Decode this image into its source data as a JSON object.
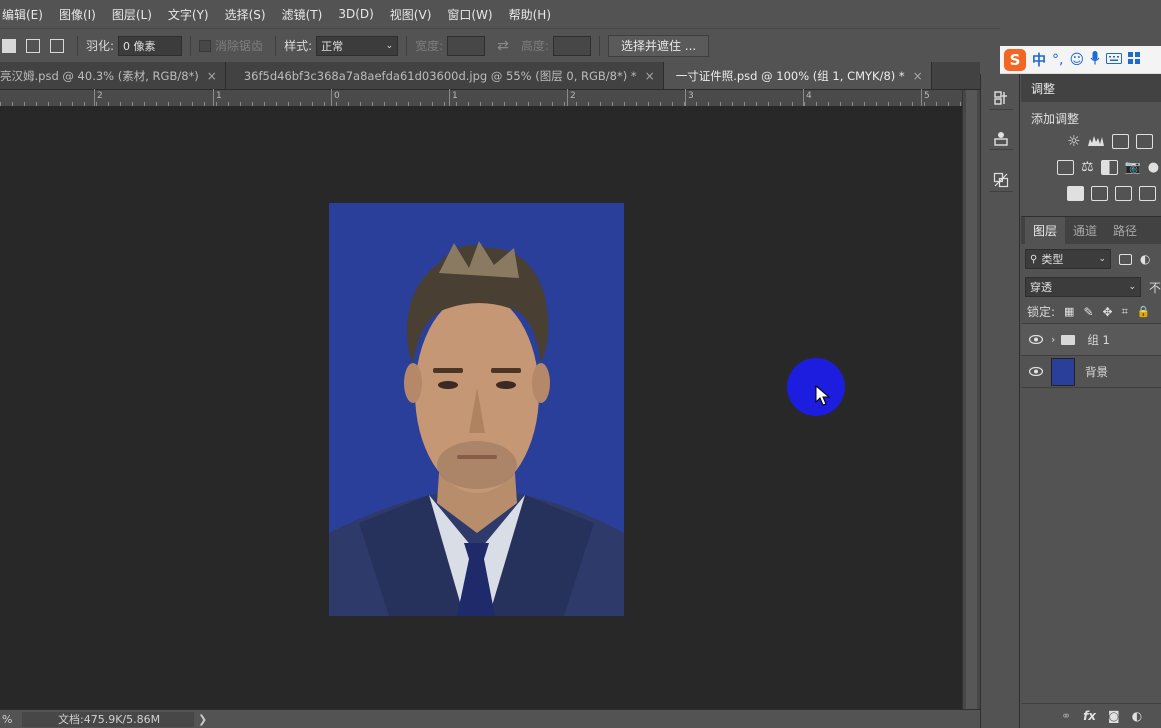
{
  "menubar": {
    "items": [
      "编辑(E)",
      "图像(I)",
      "图层(L)",
      "文字(Y)",
      "选择(S)",
      "滤镜(T)",
      "3D(D)",
      "视图(V)",
      "窗口(W)",
      "帮助(H)"
    ]
  },
  "options": {
    "feather_label": "羽化:",
    "feather_value": "0 像素",
    "antialias_label": "消除锯齿",
    "style_label": "样式:",
    "style_value": "正常",
    "width_label": "宽度:",
    "height_label": "高度:",
    "select_mask_button": "选择并遮住 ..."
  },
  "ime": {
    "logo": "S",
    "mode": "中",
    "punct": "°,"
  },
  "tabs": [
    {
      "label": "亮汉姆.psd @ 40.3% (素材, RGB/8*)",
      "close": "×"
    },
    {
      "label": "36f5d46bf3c368a7a8aefda61d03600d.jpg @ 55% (图层 0, RGB/8*) *",
      "close": "×"
    },
    {
      "label": "一寸证件照.psd @ 100% (组 1, CMYK/8) *",
      "close": "×"
    }
  ],
  "ruler": {
    "labels": [
      "2",
      "1",
      "0",
      "1",
      "2",
      "3",
      "4",
      "5"
    ]
  },
  "statusbar": {
    "zoom": "%",
    "docinfo": "文档:475.9K/5.86M",
    "arrow": "❯"
  },
  "adjustments_panel": {
    "tab": "调整",
    "title": "添加调整"
  },
  "layers_panel": {
    "tabs": [
      "图层",
      "通道",
      "路径"
    ],
    "filter_label": "类型",
    "blend_mode": "穿透",
    "opacity_label": "不",
    "lock_label": "锁定:",
    "layers": [
      {
        "name": "组 1",
        "type": "group",
        "selected": true
      },
      {
        "name": "背景",
        "type": "background",
        "selected": false
      }
    ],
    "bottom_icons": [
      "link-icon",
      "fx-icon",
      "mask-icon",
      "adjustment-icon"
    ],
    "fx_label": "fx"
  },
  "colors": {
    "photo_background": "#2a3f99",
    "cursor_highlight": "#1d1de0",
    "ime_logo": "#f26522"
  }
}
